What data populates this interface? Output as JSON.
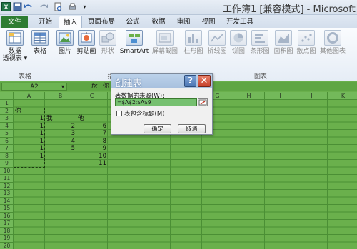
{
  "app": {
    "title": "工作簿1  [兼容模式] - Microsoft E"
  },
  "quick_access": [
    "save-icon",
    "undo-icon",
    "redo-icon",
    "print-preview-icon"
  ],
  "tabs": [
    {
      "label": "文件"
    },
    {
      "label": "开始"
    },
    {
      "label": "插入"
    },
    {
      "label": "页面布局"
    },
    {
      "label": "公式"
    },
    {
      "label": "数据"
    },
    {
      "label": "审阅"
    },
    {
      "label": "视图"
    },
    {
      "label": "开发工具"
    }
  ],
  "active_tab": "插入",
  "ribbon": {
    "buttons": [
      {
        "label": "数据",
        "label2": "透视表 ▾",
        "icon": "pivot-table-icon"
      },
      {
        "label": "表格",
        "icon": "table-icon"
      },
      {
        "label": "图片",
        "icon": "picture-icon"
      },
      {
        "label": "剪贴画",
        "icon": "clip-art-icon"
      },
      {
        "label": "形状",
        "icon": "shapes-icon"
      },
      {
        "label": "SmartArt",
        "icon": "smartart-icon"
      },
      {
        "label": "屏幕截图",
        "icon": "screenshot-icon"
      },
      {
        "label": "柱形图",
        "icon": "column-chart-icon"
      },
      {
        "label": "折线图",
        "icon": "line-chart-icon"
      },
      {
        "label": "饼图",
        "icon": "pie-chart-icon"
      },
      {
        "label": "条形图",
        "icon": "bar-chart-icon"
      },
      {
        "label": "面积图",
        "icon": "area-chart-icon"
      },
      {
        "label": "散点图",
        "icon": "scatter-chart-icon"
      },
      {
        "label": "其他图表",
        "icon": "other-charts-icon"
      }
    ],
    "groups": [
      {
        "label": "表格"
      },
      {
        "label": "插"
      },
      {
        "label": "图表"
      }
    ]
  },
  "formula_bar": {
    "name_box": "A2",
    "fx_label": "fx",
    "content": "你"
  },
  "columns": [
    "A",
    "B",
    "C",
    "D",
    "E",
    "F",
    "G",
    "H",
    "I",
    "J",
    "K"
  ],
  "rows": [
    "1",
    "2",
    "3",
    "4",
    "5",
    "6",
    "7",
    "8",
    "9",
    "10",
    "11",
    "12",
    "13",
    "14",
    "15",
    "16",
    "17",
    "18",
    "19",
    "20"
  ],
  "cells": {
    "A2": "你",
    "A3": "1",
    "B3": "我",
    "C3": "他",
    "A4": "1",
    "B4": "2",
    "C4": "6",
    "A5": "1",
    "B5": "3",
    "C5": "7",
    "A6": "1",
    "B6": "4",
    "C6": "8",
    "A7": "1",
    "B7": "5",
    "C7": "9",
    "A8": "1",
    "C8": "10",
    "C9": "11"
  },
  "dialog": {
    "title": "创建表",
    "help": "?",
    "close": "✕",
    "source_label": "表数据的来源(W):",
    "source_value": "=$A$2:$A$9",
    "header_checkbox_label": "表包含标题(M)",
    "header_checked": false,
    "ok_label": "确定",
    "cancel_label": "取消"
  }
}
